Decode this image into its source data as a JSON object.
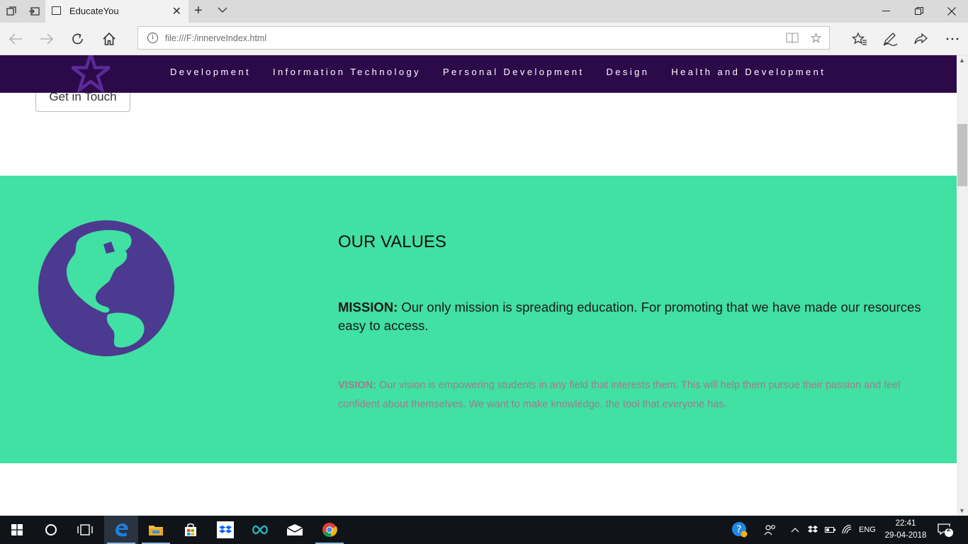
{
  "browser": {
    "tab_title": "EducateYou",
    "url": "file:///F:/innerveIndex.html"
  },
  "site": {
    "nav_items": [
      "Development",
      "Information Technology",
      "Personal Development",
      "Design",
      "Health and Development"
    ],
    "get_in_touch_label": "Get in Touch"
  },
  "values_section": {
    "heading": "OUR VALUES",
    "mission_label": "MISSION:",
    "mission_text": " Our only mission is spreading education. For promoting that we have made our resources easy to access.",
    "vision_label": "VISION:",
    "vision_text": " Our vision is empowering students in any field that interests them. This will help them pursue their passion and feel confident about themselves. We want to make knowledge, the tool that everyone has."
  },
  "taskbar": {
    "language": "ENG",
    "time": "22:41",
    "date": "29-04-2018",
    "notification_count": "2"
  },
  "colors": {
    "site_nav_bg": "#2c0a4a",
    "values_bg": "#41e0a3",
    "globe": "#4b3a8f",
    "logo_star": "#5b2a9a"
  },
  "icons": [
    "tab-manager-icon",
    "set-aside-tabs-icon",
    "page-icon",
    "close-icon",
    "new-tab-icon",
    "tab-list-icon",
    "minimize-icon",
    "restore-icon",
    "back-icon",
    "forward-icon",
    "refresh-icon",
    "home-icon",
    "info-icon",
    "reading-view-icon",
    "favorite-star-icon",
    "favorites-icon",
    "notes-icon",
    "share-icon",
    "more-icon",
    "star-logo-icon",
    "globe-icon",
    "windows-start-icon",
    "cortana-icon",
    "task-view-icon",
    "edge-icon",
    "file-explorer-icon",
    "store-icon",
    "dropbox-icon",
    "arduino-icon",
    "mail-icon",
    "chrome-icon"
  ]
}
